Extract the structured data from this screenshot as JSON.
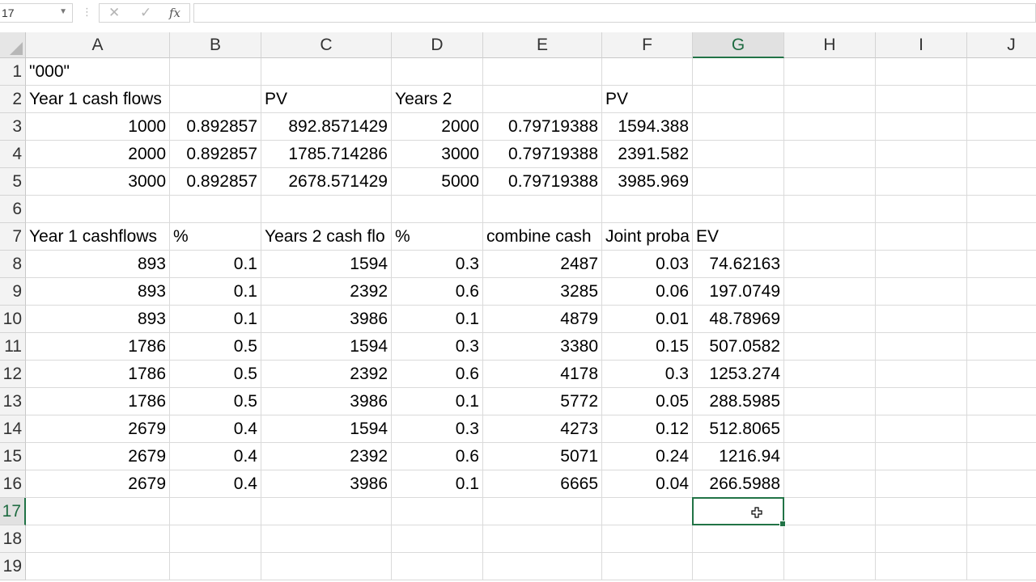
{
  "formula_bar": {
    "name_box": "17",
    "cancel_glyph": "✕",
    "enter_glyph": "✓",
    "fx_label": "fx",
    "formula": ""
  },
  "columns": [
    "A",
    "B",
    "C",
    "D",
    "E",
    "F",
    "G",
    "H",
    "I",
    "J"
  ],
  "row_numbers": [
    "1",
    "2",
    "3",
    "4",
    "5",
    "6",
    "7",
    "8",
    "9",
    "10",
    "11",
    "12",
    "13",
    "14",
    "15",
    "16",
    "17",
    "18",
    "19"
  ],
  "active_cell": {
    "col": "G",
    "row": "17"
  },
  "cells": {
    "A1": "\"000\"",
    "A2": "Year 1 cash flows",
    "C2": "PV",
    "D2": "Years 2",
    "F2": "PV",
    "A3": "1000",
    "B3": "0.892857",
    "C3": "892.8571429",
    "D3": "2000",
    "E3": "0.79719388",
    "F3": "1594.388",
    "A4": "2000",
    "B4": "0.892857",
    "C4": "1785.714286",
    "D4": "3000",
    "E4": "0.79719388",
    "F4": "2391.582",
    "A5": "3000",
    "B5": "0.892857",
    "C5": "2678.571429",
    "D5": "5000",
    "E5": "0.79719388",
    "F5": "3985.969",
    "A7": "Year 1 cashflows",
    "B7": "%",
    "C7": "Years 2 cash flo",
    "D7": "%",
    "E7": "combine cash",
    "F7": "Joint proba",
    "G7": "EV",
    "A8": "893",
    "B8": "0.1",
    "C8": "1594",
    "D8": "0.3",
    "E8": "2487",
    "F8": "0.03",
    "G8": "74.62163",
    "A9": "893",
    "B9": "0.1",
    "C9": "2392",
    "D9": "0.6",
    "E9": "3285",
    "F9": "0.06",
    "G9": "197.0749",
    "A10": "893",
    "B10": "0.1",
    "C10": "3986",
    "D10": "0.1",
    "E10": "4879",
    "F10": "0.01",
    "G10": "48.78969",
    "A11": "1786",
    "B11": "0.5",
    "C11": "1594",
    "D11": "0.3",
    "E11": "3380",
    "F11": "0.15",
    "G11": "507.0582",
    "A12": "1786",
    "B12": "0.5",
    "C12": "2392",
    "D12": "0.6",
    "E12": "4178",
    "F12": "0.3",
    "G12": "1253.274",
    "A13": "1786",
    "B13": "0.5",
    "C13": "3986",
    "D13": "0.1",
    "E13": "5772",
    "F13": "0.05",
    "G13": "288.5985",
    "A14": "2679",
    "B14": "0.4",
    "C14": "1594",
    "D14": "0.3",
    "E14": "4273",
    "F14": "0.12",
    "G14": "512.8065",
    "A15": "2679",
    "B15": "0.4",
    "C15": "2392",
    "D15": "0.6",
    "E15": "5071",
    "F15": "0.24",
    "G15": "1216.94",
    "A16": "2679",
    "B16": "0.4",
    "C16": "3986",
    "D16": "0.1",
    "E16": "6665",
    "F16": "0.04",
    "G16": "266.5988"
  },
  "colors": {
    "accent": "#217346",
    "header_bg": "#f3f3f3",
    "gridline": "#dadada"
  }
}
